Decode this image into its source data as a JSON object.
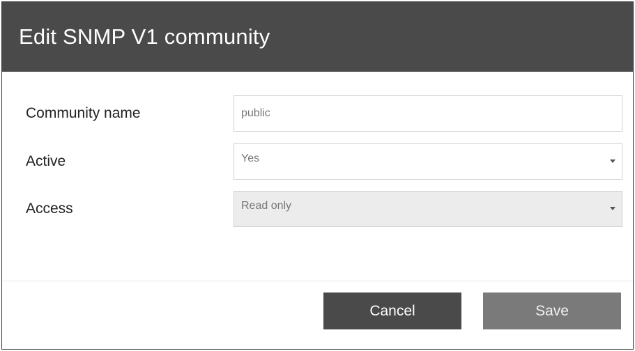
{
  "dialog": {
    "title": "Edit SNMP V1 community"
  },
  "form": {
    "community_name": {
      "label": "Community name",
      "value": "public"
    },
    "active": {
      "label": "Active",
      "selected": "Yes"
    },
    "access": {
      "label": "Access",
      "selected": "Read only"
    }
  },
  "actions": {
    "cancel_label": "Cancel",
    "save_label": "Save"
  },
  "colors": {
    "header_bg": "#4a4a4a",
    "cancel_bg": "#4a4a4a",
    "save_bg": "#7a7a7a",
    "disabled_field_bg": "#ececec"
  }
}
